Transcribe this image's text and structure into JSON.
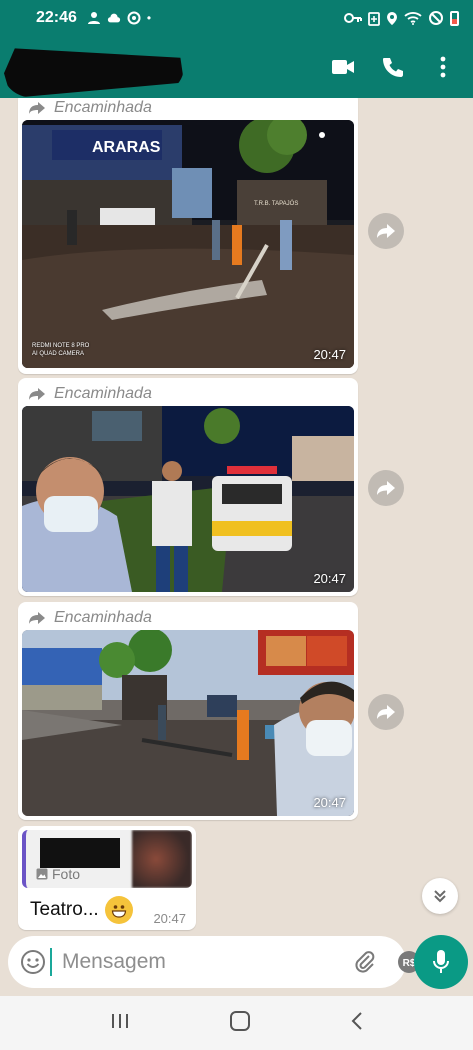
{
  "status_bar": {
    "time": "22:46",
    "battery_color": "#f35b4b"
  },
  "header": {
    "contact_name_redacted": true,
    "actions": [
      "video-call-icon",
      "phone-icon",
      "more-vert-icon"
    ]
  },
  "messages": [
    {
      "forwarded_label": "Encaminhada",
      "time": "20:47",
      "watermark_line1": "REDMI NOTE 8 PRO",
      "watermark_line2": "AI QUAD CAMERA",
      "store_sign": "ARARAS",
      "truck_label": "T.R.B. TAPAJÓS"
    },
    {
      "forwarded_label": "Encaminhada",
      "time": "20:47"
    },
    {
      "forwarded_label": "Encaminhada",
      "time": "20:47"
    }
  ],
  "reply_message": {
    "quote_type": "Foto",
    "text": "Teatro...",
    "emoji": "grinning-face",
    "time": "20:47",
    "quote_accent": "#6b54c6"
  },
  "composer": {
    "placeholder": "Mensagem"
  },
  "colors": {
    "header": "#0a7d6f",
    "mic": "#0a9a85",
    "chat_bg": "#e8dfd5"
  }
}
